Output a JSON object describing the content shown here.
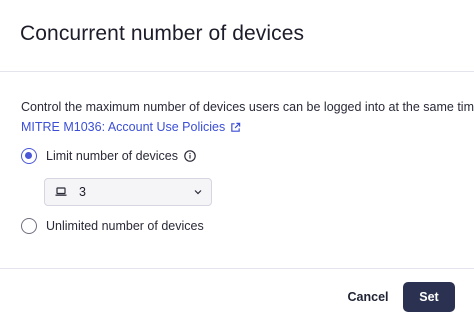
{
  "dialog": {
    "title": "Concurrent number of devices",
    "description": "Control the maximum number of devices users can be logged into at the same time.",
    "link_text": "MITRE M1036: Account Use Policies",
    "options": {
      "limit": {
        "label": "Limit number of devices",
        "selected": true
      },
      "unlimited": {
        "label": "Unlimited number of devices",
        "selected": false
      }
    },
    "device_select": {
      "value": "3",
      "icon": "laptop-icon"
    },
    "buttons": {
      "cancel": "Cancel",
      "set": "Set"
    }
  },
  "colors": {
    "accent": "#4a57d8",
    "link": "#3b4fd6",
    "primary_button": "#2b3150"
  }
}
